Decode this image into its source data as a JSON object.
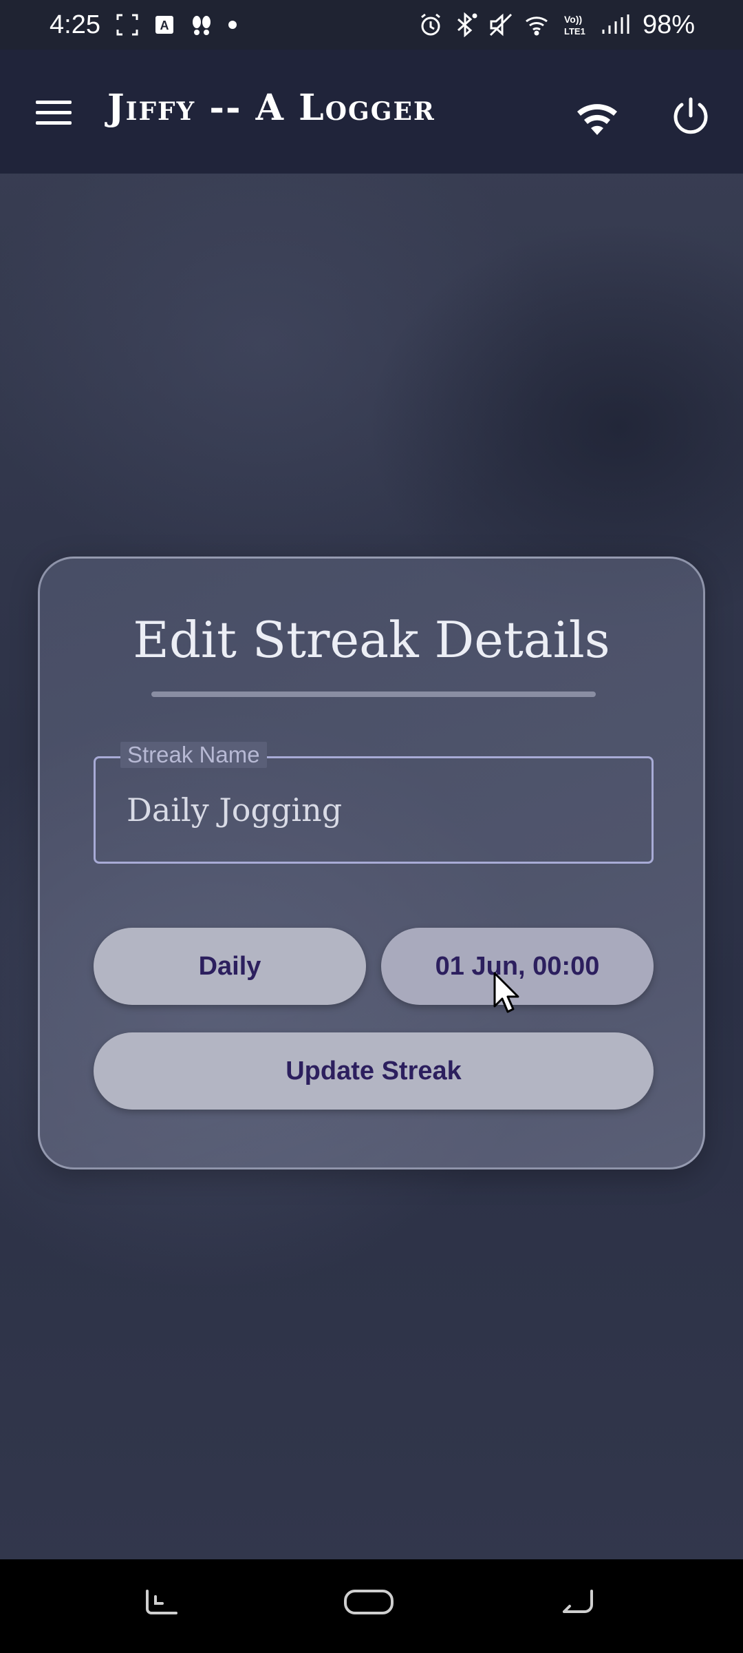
{
  "status_bar": {
    "time": "4:25",
    "battery": "98%",
    "icons": [
      "screenshot-icon",
      "keyboard-a-icon",
      "footsteps-icon",
      "dot-icon",
      "alarm-icon",
      "bluetooth-icon",
      "mute-icon",
      "wifi-icon",
      "volte-icon",
      "signal-icon"
    ]
  },
  "app_bar": {
    "title": "Jiffy -- A Logger",
    "icons": [
      "menu-icon",
      "wifi-icon",
      "power-icon"
    ]
  },
  "card": {
    "title": "Edit Streak Details",
    "streak_name_field": {
      "label": "Streak Name",
      "value": "Daily Jogging"
    },
    "frequency_button": "Daily",
    "date_button": "01 Jun, 00:00",
    "update_button": "Update Streak"
  },
  "nav_bar": {
    "icons": [
      "recent-apps-icon",
      "home-icon",
      "back-icon"
    ]
  },
  "colors": {
    "app_bar": "#20243a",
    "button_text": "#2c1f5e",
    "field_border": "#a8abd6"
  }
}
